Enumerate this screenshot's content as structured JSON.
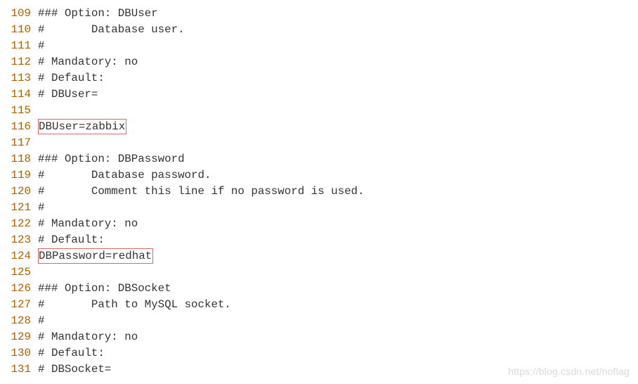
{
  "watermark": "https://blog.csdn.net/noflag",
  "highlight_lines": [
    116,
    124
  ],
  "lines": [
    {
      "num": 109,
      "text": "### Option: DBUser"
    },
    {
      "num": 110,
      "text": "#       Database user."
    },
    {
      "num": 111,
      "text": "#"
    },
    {
      "num": 112,
      "text": "# Mandatory: no"
    },
    {
      "num": 113,
      "text": "# Default:"
    },
    {
      "num": 114,
      "text": "# DBUser="
    },
    {
      "num": 115,
      "text": ""
    },
    {
      "num": 116,
      "text": "DBUser=zabbix"
    },
    {
      "num": 117,
      "text": ""
    },
    {
      "num": 118,
      "text": "### Option: DBPassword"
    },
    {
      "num": 119,
      "text": "#       Database password."
    },
    {
      "num": 120,
      "text": "#       Comment this line if no password is used."
    },
    {
      "num": 121,
      "text": "#"
    },
    {
      "num": 122,
      "text": "# Mandatory: no"
    },
    {
      "num": 123,
      "text": "# Default:"
    },
    {
      "num": 124,
      "text": "DBPassword=redhat"
    },
    {
      "num": 125,
      "text": ""
    },
    {
      "num": 126,
      "text": "### Option: DBSocket"
    },
    {
      "num": 127,
      "text": "#       Path to MySQL socket."
    },
    {
      "num": 128,
      "text": "#"
    },
    {
      "num": 129,
      "text": "# Mandatory: no"
    },
    {
      "num": 130,
      "text": "# Default:"
    },
    {
      "num": 131,
      "text": "# DBSocket="
    }
  ]
}
